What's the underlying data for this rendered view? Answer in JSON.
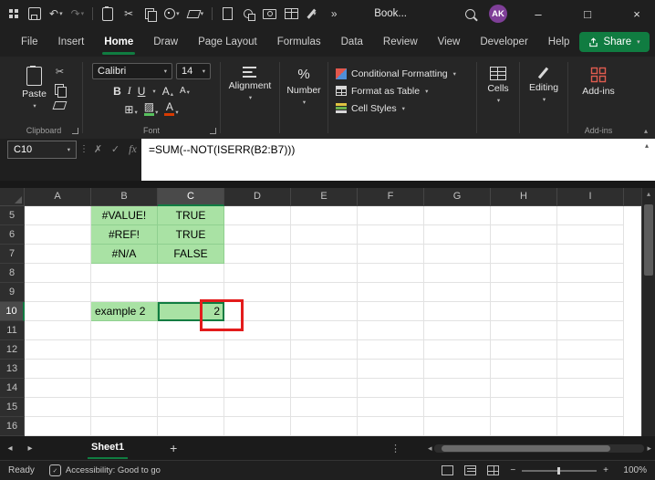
{
  "colors": {
    "accent": "#107C41",
    "green_fill": "#A9E2A4",
    "annotation_red": "#E31C1C",
    "avatar_purple": "#7F3F98"
  },
  "titlebar": {
    "doc_name": "Book...",
    "avatar": "AK"
  },
  "glyphs": {
    "dropdown": "▾",
    "undo": "↶",
    "redo": "↷",
    "cut": "✂",
    "more": "»",
    "dots_v": "⋮",
    "cancel": "✗",
    "enter": "✓",
    "left": "◂",
    "right": "▸",
    "up": "▴",
    "plus": "+",
    "minus": "−",
    "percent": "%",
    "borders": "⊞",
    "fill": "▨",
    "letter_a": "A",
    "bold": "B",
    "italic": "I",
    "underline": "U",
    "minimize": "–",
    "maximize": "□",
    "close": "×",
    "check": "✓"
  },
  "tabs": [
    {
      "label": "File"
    },
    {
      "label": "Insert"
    },
    {
      "label": "Home"
    },
    {
      "label": "Draw"
    },
    {
      "label": "Page Layout"
    },
    {
      "label": "Formulas"
    },
    {
      "label": "Data"
    },
    {
      "label": "Review"
    },
    {
      "label": "View"
    },
    {
      "label": "Developer"
    },
    {
      "label": "Help"
    }
  ],
  "share": {
    "label": "Share"
  },
  "ribbon": {
    "paste": "Paste",
    "clipboard_group": "Clipboard",
    "font_name": "Calibri",
    "font_size": "14",
    "font_group": "Font",
    "alignment": "Alignment",
    "number": "Number",
    "conditional_formatting": "Conditional Formatting",
    "format_as_table": "Format as Table",
    "cell_styles": "Cell Styles",
    "cells": "Cells",
    "editing": "Editing",
    "addins": "Add-ins",
    "addins_group": "Add-ins"
  },
  "formula_bar": {
    "name_box": "C10",
    "fx": "fx",
    "formula": "=SUM(--NOT(ISERR(B2:B7)))"
  },
  "grid": {
    "columns": [
      "A",
      "B",
      "C",
      "D",
      "E",
      "F",
      "G",
      "H",
      "I"
    ],
    "rows": [
      "5",
      "6",
      "7",
      "8",
      "9",
      "10",
      "11",
      "12",
      "13",
      "14",
      "15",
      "16"
    ],
    "selected_column": "C",
    "selected_row": "10",
    "selected_cell": "C10",
    "green_cells": [
      "B5",
      "C5",
      "B6",
      "C6",
      "B7",
      "C7",
      "B10",
      "C10"
    ],
    "align": {
      "B10": "left",
      "C10": "right"
    },
    "cells": {
      "B5": "#VALUE!",
      "C5": "TRUE",
      "B6": "#REF!",
      "C6": "TRUE",
      "B7": "#N/A",
      "C7": "FALSE",
      "B10": "example 2",
      "C10": "2"
    }
  },
  "sheetbar": {
    "sheet": "Sheet1",
    "add": "+"
  },
  "statusbar": {
    "ready": "Ready",
    "accessibility": "Accessibility: Good to go",
    "zoom": "100%"
  }
}
